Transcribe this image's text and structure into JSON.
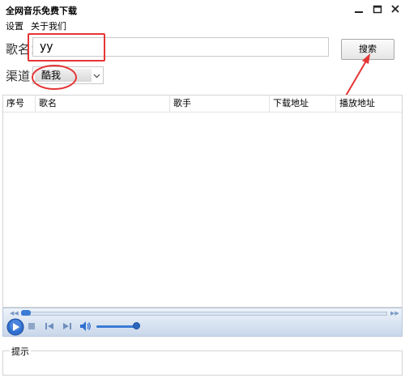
{
  "window": {
    "title": "全网音乐免费下载"
  },
  "menu": {
    "items": [
      "设置",
      "关于我们"
    ]
  },
  "search": {
    "song_label": "歌名：",
    "song_value": "yy",
    "button_label": "搜索"
  },
  "channel": {
    "label": "渠道：",
    "selected": "酷我"
  },
  "table": {
    "columns": [
      "序号",
      "歌名",
      "歌手",
      "下载地址",
      "播放地址"
    ],
    "rows": []
  },
  "player": {
    "seek_progress": 0.0,
    "volume_level": 0.9
  },
  "tips": {
    "legend": "提示"
  },
  "colors": {
    "annotation_red": "#e53535",
    "player_blue": "#3a7bd5"
  }
}
